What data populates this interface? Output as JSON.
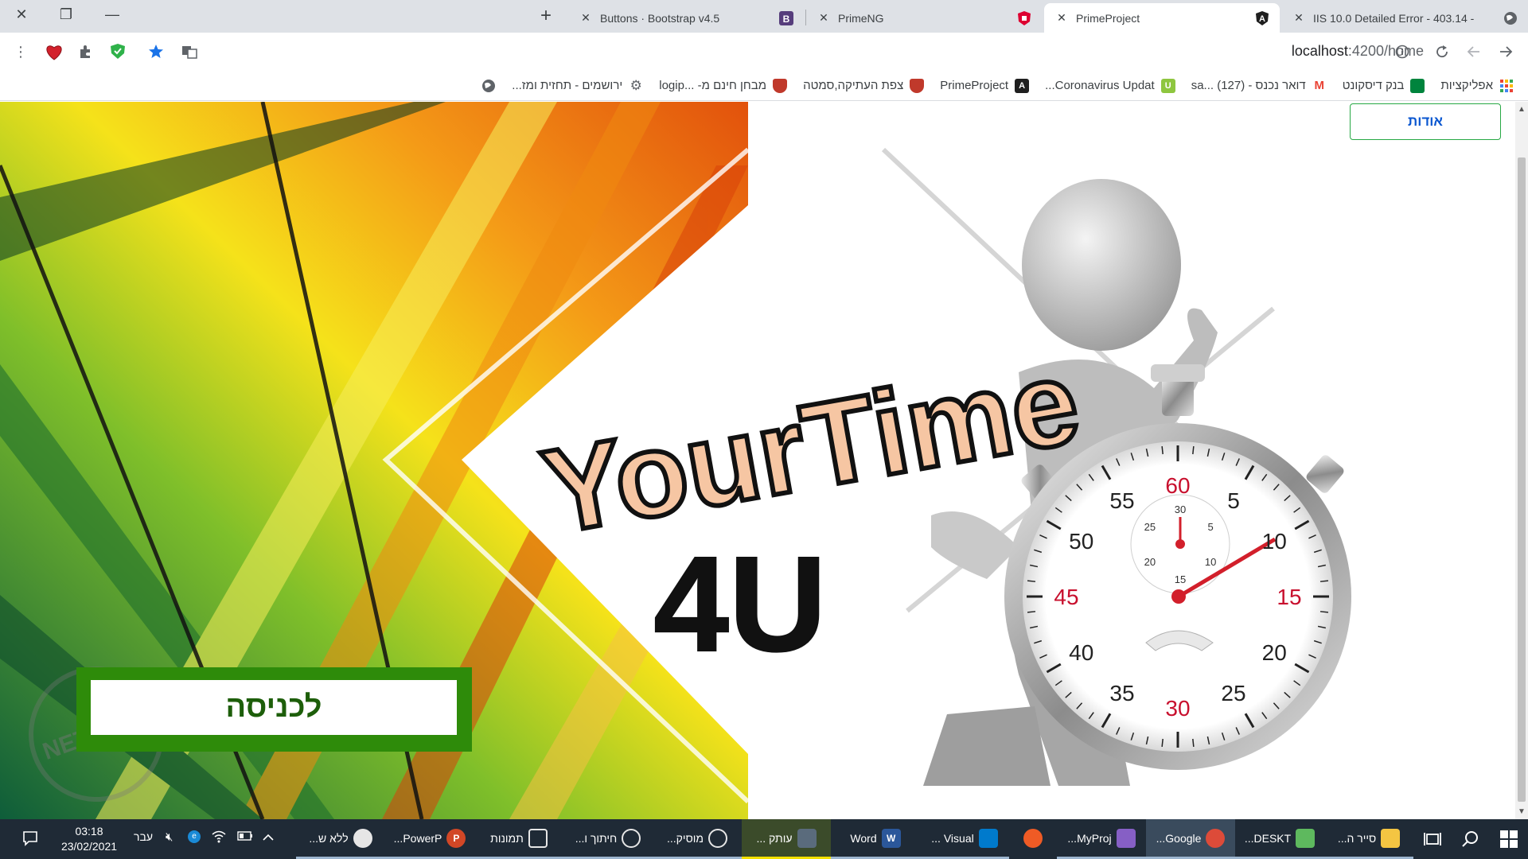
{
  "window": {
    "controls": {
      "close": "✕",
      "restore": "❐",
      "minimize": "—"
    }
  },
  "tabs": [
    {
      "title": "Buttons · Bootstrap v4.5",
      "favicon": "B",
      "favicon_color": "#563d7c",
      "active": false
    },
    {
      "title": "PrimeNG",
      "favicon": "shield",
      "favicon_color": "#dd0031",
      "active": false
    },
    {
      "title": "PrimeProject",
      "favicon": "A",
      "favicon_color": "#1f1f1f",
      "active": true
    },
    {
      "title": "IIS 10.0 Detailed Error - 403.14 -",
      "favicon": "globe",
      "favicon_color": "#5f6368",
      "active": false
    }
  ],
  "toolbar": {
    "url_host": "localhost",
    "url_rest": ":4200/home",
    "extensions": [
      "heart-extension",
      "puzzle-icon",
      "shield-extension",
      "star-icon",
      "translate-icon"
    ]
  },
  "bookmarks": [
    {
      "label": "אפליקציות",
      "icon": "apps",
      "color": "#ea4335"
    },
    {
      "label": "בנק דיסקונט",
      "icon": "bank",
      "color": "#00843d"
    },
    {
      "label": "דואר נכנס - sa... (127)",
      "icon": "M",
      "color": "#ea4335"
    },
    {
      "label": "Coronavirus Updat...",
      "icon": "U",
      "color": "#8ec63f"
    },
    {
      "label": "PrimeProject",
      "icon": "A",
      "color": "#1f1f1f"
    },
    {
      "label": "צפת העתיקה,סמטה",
      "icon": "shield",
      "color": "#c0392b"
    },
    {
      "label": "מבחן חינם מ- ...logip",
      "icon": "shield",
      "color": "#c0392b"
    },
    {
      "label": "ירושמים - תחזית ומז...",
      "icon": "gear",
      "color": "#5f6368"
    },
    {
      "label": "",
      "icon": "globe",
      "color": "#5f6368"
    }
  ],
  "page": {
    "about_label": "אודות",
    "enter_label": "לכניסה",
    "logo_line1": "YourTime",
    "logo_line2": "4U",
    "watermark": "NETFREE",
    "dial_numbers": [
      "60",
      "5",
      "10",
      "15",
      "20",
      "25",
      "30",
      "35",
      "40",
      "45",
      "50",
      "55"
    ],
    "subdial_numbers": [
      "30",
      "5",
      "10",
      "15",
      "20",
      "25"
    ]
  },
  "taskbar": {
    "items": [
      {
        "label": "",
        "icon": "windows",
        "color": "#ffffff"
      },
      {
        "label": "",
        "icon": "search",
        "color": "#ffffff"
      },
      {
        "label": "",
        "icon": "task-view",
        "color": "#ffffff"
      },
      {
        "label": "סייר ה...",
        "icon": "folder",
        "color": "#f4c542"
      },
      {
        "label": "DESKT...",
        "icon": "remote",
        "color": "#5eb95e"
      },
      {
        "label": "Google...",
        "icon": "chrome",
        "color": "#dd4b39",
        "active": true
      },
      {
        "label": "MyProj...",
        "icon": "vs",
        "color": "#865fc5"
      },
      {
        "label": "",
        "icon": "postman",
        "color": "#ef5b25"
      },
      {
        "label": "Visual ...",
        "icon": "vscode",
        "color": "#007acc"
      },
      {
        "label": "Word",
        "icon": "W",
        "color": "#2b579a"
      },
      {
        "label": "עותק ...",
        "icon": "movie",
        "color": "#5a6b7c"
      },
      {
        "label": "מוסיק...",
        "icon": "groove",
        "color": "#e6e6e6"
      },
      {
        "label": "חיתוך ו...",
        "icon": "snip",
        "color": "#e6e6e6"
      },
      {
        "label": "תמונות",
        "icon": "photos",
        "color": "#e6e6e6"
      },
      {
        "label": "PowerP...",
        "icon": "P",
        "color": "#d24726"
      },
      {
        "label": "ללא ש...",
        "icon": "paint",
        "color": "#e6e6e6"
      }
    ],
    "tray": {
      "time": "03:18",
      "date": "23/02/2021",
      "language": "עבר"
    }
  }
}
